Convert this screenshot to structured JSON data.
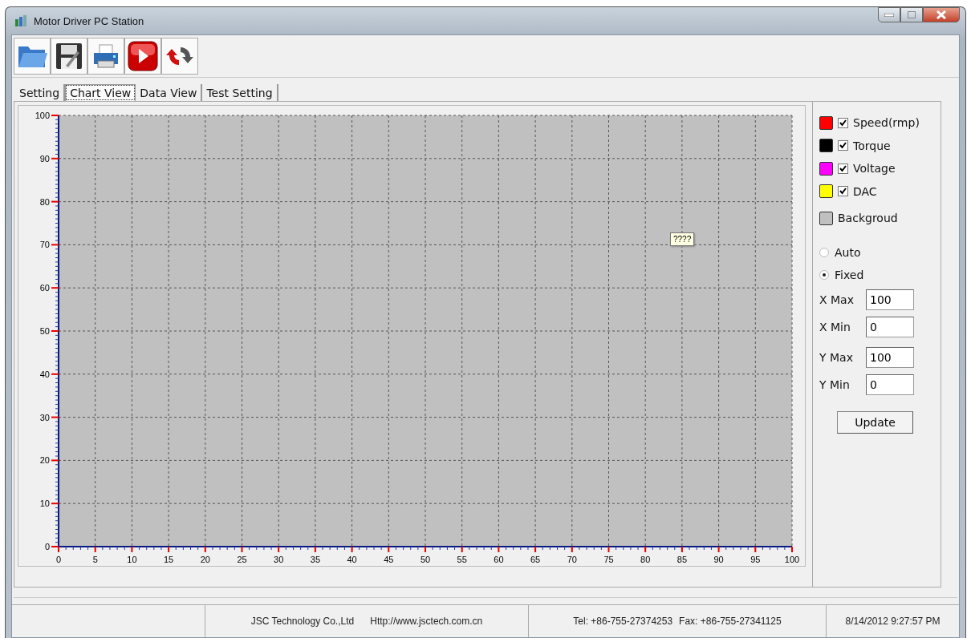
{
  "window": {
    "title": "Motor Driver PC Station"
  },
  "tabs": [
    {
      "label": "Setting",
      "selected": false
    },
    {
      "label": "Chart View",
      "selected": true
    },
    {
      "label": "Data View",
      "selected": false
    },
    {
      "label": "Test Setting",
      "selected": false
    }
  ],
  "chart_data": {
    "type": "line",
    "grid": true,
    "xlim": [
      0,
      100
    ],
    "ylim": [
      0,
      100
    ],
    "xticks": [
      0,
      5,
      10,
      15,
      20,
      25,
      30,
      35,
      40,
      45,
      50,
      55,
      60,
      65,
      70,
      75,
      80,
      85,
      90,
      95,
      100
    ],
    "yticks": [
      0,
      10,
      20,
      30,
      40,
      50,
      60,
      70,
      80,
      90,
      100
    ]
  },
  "tooltip": "????",
  "legend": [
    {
      "kind": "series",
      "label": "Speed(rmp)",
      "color": "#ff0000",
      "checked": true
    },
    {
      "kind": "series",
      "label": "Torque",
      "color": "#000000",
      "checked": true
    },
    {
      "kind": "series",
      "label": "Voltage",
      "color": "#ff00ff",
      "checked": true
    },
    {
      "kind": "series",
      "label": "DAC",
      "color": "#ffff00",
      "checked": true
    },
    {
      "kind": "background",
      "label": "Backgroud",
      "color": "#c0c0c0"
    }
  ],
  "scale_mode": [
    {
      "label": "Auto",
      "selected": false
    },
    {
      "label": "Fixed",
      "selected": true
    }
  ],
  "fields": [
    {
      "label": "X Max",
      "value": "100"
    },
    {
      "label": "X Min",
      "value": "0"
    },
    {
      "label": "Y Max",
      "value": "100"
    },
    {
      "label": "Y Min",
      "value": "0"
    }
  ],
  "update_button": "Update",
  "status_bar": {
    "company": "JSC Technology Co.,Ltd",
    "website": "Http://www.jsctech.com.cn",
    "phone": "Tel: +86-755-27374253",
    "fax": "Fax: +86-755-27341125",
    "datetime": "8/14/2012 9:27:57 PM"
  }
}
